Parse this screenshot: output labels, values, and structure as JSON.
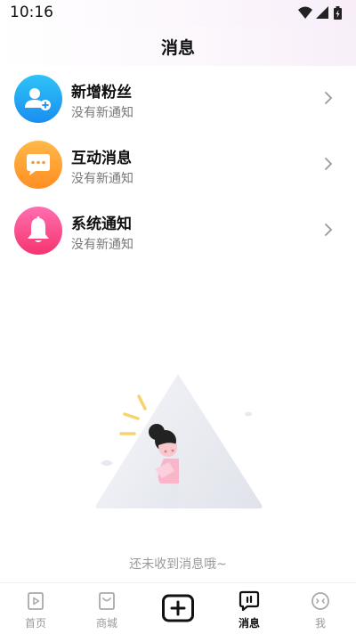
{
  "status_bar": {
    "time": "10:16"
  },
  "header": {
    "title": "消息"
  },
  "messages": [
    {
      "title": "新增粉丝",
      "subtitle": "没有新通知",
      "icon": "new-followers-icon",
      "color_from": "#2ec3f7",
      "color_to": "#1a8ef0"
    },
    {
      "title": "互动消息",
      "subtitle": "没有新通知",
      "icon": "chat-bubble-icon",
      "color_from": "#ffb84a",
      "color_to": "#ff8f22"
    },
    {
      "title": "系统通知",
      "subtitle": "没有新通知",
      "icon": "bell-icon",
      "color_from": "#ff6fb0",
      "color_to": "#f5346f"
    }
  ],
  "empty_state": {
    "text": "还未收到消息哦~"
  },
  "tabbar": {
    "items": [
      {
        "label": "首页",
        "icon": "home-play-icon",
        "active": false
      },
      {
        "label": "商城",
        "icon": "shopping-bag-icon",
        "active": false
      },
      {
        "label": "",
        "icon": "plus-box-icon",
        "active": false
      },
      {
        "label": "消息",
        "icon": "message-icon",
        "active": true
      },
      {
        "label": "我",
        "icon": "profile-face-icon",
        "active": false
      }
    ]
  }
}
